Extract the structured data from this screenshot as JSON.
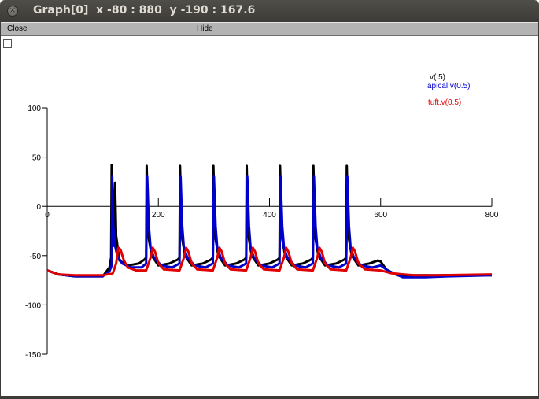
{
  "window": {
    "title": "Graph[0]  x -80 : 880  y -190 : 167.6",
    "close_glyph": "×"
  },
  "menubar": {
    "close_label": "Close",
    "hide_label": "Hide"
  },
  "chart_data": {
    "type": "line",
    "xlim": [
      0,
      800
    ],
    "ylim": [
      -150,
      100
    ],
    "x_ticks": [
      0,
      200,
      400,
      600,
      800
    ],
    "y_ticks": [
      100,
      50,
      0,
      -50,
      -100,
      -150
    ],
    "legend_placement": "top-right",
    "grid": false,
    "series": [
      {
        "name": "v(.5)",
        "color": "#000000",
        "points": [
          [
            0,
            -65
          ],
          [
            20,
            -69
          ],
          [
            50,
            -71
          ],
          [
            100,
            -71
          ],
          [
            112,
            -62
          ],
          [
            115,
            -52
          ],
          [
            116,
            42
          ],
          [
            118,
            -28
          ],
          [
            120,
            -40
          ],
          [
            122,
            24
          ],
          [
            124,
            -30
          ],
          [
            130,
            -55
          ],
          [
            145,
            -60
          ],
          [
            165,
            -58
          ],
          [
            175,
            -54
          ],
          [
            178,
            -52
          ],
          [
            179,
            41
          ],
          [
            182,
            -30
          ],
          [
            188,
            -50
          ],
          [
            200,
            -60
          ],
          [
            220,
            -58
          ],
          [
            235,
            -54
          ],
          [
            238,
            -52
          ],
          [
            239,
            41
          ],
          [
            242,
            -30
          ],
          [
            248,
            -50
          ],
          [
            260,
            -60
          ],
          [
            280,
            -58
          ],
          [
            295,
            -54
          ],
          [
            298,
            -52
          ],
          [
            299,
            41
          ],
          [
            302,
            -30
          ],
          [
            308,
            -50
          ],
          [
            320,
            -60
          ],
          [
            340,
            -58
          ],
          [
            355,
            -54
          ],
          [
            358,
            -52
          ],
          [
            359,
            41
          ],
          [
            362,
            -30
          ],
          [
            368,
            -50
          ],
          [
            380,
            -60
          ],
          [
            400,
            -58
          ],
          [
            415,
            -54
          ],
          [
            418,
            -52
          ],
          [
            419,
            41
          ],
          [
            422,
            -30
          ],
          [
            428,
            -50
          ],
          [
            440,
            -60
          ],
          [
            460,
            -58
          ],
          [
            475,
            -54
          ],
          [
            478,
            -52
          ],
          [
            479,
            41
          ],
          [
            482,
            -30
          ],
          [
            488,
            -50
          ],
          [
            500,
            -60
          ],
          [
            520,
            -58
          ],
          [
            535,
            -54
          ],
          [
            538,
            -52
          ],
          [
            539,
            41
          ],
          [
            542,
            -30
          ],
          [
            548,
            -50
          ],
          [
            560,
            -60
          ],
          [
            580,
            -58
          ],
          [
            595,
            -55
          ],
          [
            600,
            -56
          ],
          [
            610,
            -64
          ],
          [
            630,
            -70
          ],
          [
            660,
            -70
          ],
          [
            700,
            -70
          ],
          [
            800,
            -70
          ]
        ]
      },
      {
        "name": "apical.v(0.5)",
        "color": "#0000cc",
        "points": [
          [
            0,
            -65
          ],
          [
            20,
            -69
          ],
          [
            50,
            -71
          ],
          [
            100,
            -71
          ],
          [
            112,
            -66
          ],
          [
            116,
            -60
          ],
          [
            117,
            30
          ],
          [
            119,
            -20
          ],
          [
            122,
            -40
          ],
          [
            126,
            -50
          ],
          [
            135,
            -58
          ],
          [
            150,
            -62
          ],
          [
            170,
            -62
          ],
          [
            178,
            -58
          ],
          [
            180,
            30
          ],
          [
            183,
            -20
          ],
          [
            186,
            -42
          ],
          [
            192,
            -52
          ],
          [
            205,
            -60
          ],
          [
            225,
            -62
          ],
          [
            238,
            -58
          ],
          [
            240,
            30
          ],
          [
            243,
            -20
          ],
          [
            246,
            -42
          ],
          [
            252,
            -52
          ],
          [
            265,
            -60
          ],
          [
            285,
            -62
          ],
          [
            298,
            -58
          ],
          [
            300,
            30
          ],
          [
            303,
            -20
          ],
          [
            306,
            -42
          ],
          [
            312,
            -52
          ],
          [
            325,
            -60
          ],
          [
            345,
            -62
          ],
          [
            358,
            -58
          ],
          [
            360,
            30
          ],
          [
            363,
            -20
          ],
          [
            366,
            -42
          ],
          [
            372,
            -52
          ],
          [
            385,
            -60
          ],
          [
            405,
            -62
          ],
          [
            418,
            -58
          ],
          [
            420,
            30
          ],
          [
            423,
            -20
          ],
          [
            426,
            -42
          ],
          [
            432,
            -52
          ],
          [
            445,
            -60
          ],
          [
            465,
            -62
          ],
          [
            478,
            -58
          ],
          [
            480,
            30
          ],
          [
            483,
            -20
          ],
          [
            486,
            -42
          ],
          [
            492,
            -52
          ],
          [
            505,
            -60
          ],
          [
            525,
            -62
          ],
          [
            538,
            -58
          ],
          [
            540,
            30
          ],
          [
            543,
            -20
          ],
          [
            546,
            -42
          ],
          [
            552,
            -52
          ],
          [
            565,
            -60
          ],
          [
            585,
            -62
          ],
          [
            600,
            -60
          ],
          [
            615,
            -66
          ],
          [
            640,
            -72
          ],
          [
            680,
            -72
          ],
          [
            720,
            -71
          ],
          [
            800,
            -70
          ]
        ]
      },
      {
        "name": "tuft.v(0.5)",
        "color": "#e00000",
        "points": [
          [
            0,
            -65
          ],
          [
            20,
            -69
          ],
          [
            50,
            -70
          ],
          [
            100,
            -70
          ],
          [
            118,
            -68
          ],
          [
            124,
            -58
          ],
          [
            128,
            -42
          ],
          [
            132,
            -44
          ],
          [
            138,
            -55
          ],
          [
            145,
            -62
          ],
          [
            160,
            -65
          ],
          [
            178,
            -65
          ],
          [
            186,
            -52
          ],
          [
            190,
            -42
          ],
          [
            194,
            -46
          ],
          [
            200,
            -58
          ],
          [
            210,
            -64
          ],
          [
            238,
            -65
          ],
          [
            246,
            -52
          ],
          [
            250,
            -42
          ],
          [
            254,
            -46
          ],
          [
            260,
            -58
          ],
          [
            270,
            -64
          ],
          [
            298,
            -65
          ],
          [
            306,
            -52
          ],
          [
            310,
            -42
          ],
          [
            314,
            -46
          ],
          [
            320,
            -58
          ],
          [
            330,
            -64
          ],
          [
            358,
            -65
          ],
          [
            366,
            -52
          ],
          [
            370,
            -42
          ],
          [
            374,
            -46
          ],
          [
            380,
            -58
          ],
          [
            390,
            -64
          ],
          [
            418,
            -65
          ],
          [
            426,
            -52
          ],
          [
            430,
            -42
          ],
          [
            434,
            -46
          ],
          [
            440,
            -58
          ],
          [
            450,
            -64
          ],
          [
            478,
            -65
          ],
          [
            486,
            -52
          ],
          [
            490,
            -42
          ],
          [
            494,
            -46
          ],
          [
            500,
            -58
          ],
          [
            510,
            -64
          ],
          [
            538,
            -65
          ],
          [
            546,
            -52
          ],
          [
            550,
            -42
          ],
          [
            554,
            -46
          ],
          [
            560,
            -58
          ],
          [
            572,
            -64
          ],
          [
            600,
            -65
          ],
          [
            620,
            -68
          ],
          [
            660,
            -70
          ],
          [
            700,
            -70
          ],
          [
            800,
            -69
          ]
        ]
      }
    ]
  }
}
